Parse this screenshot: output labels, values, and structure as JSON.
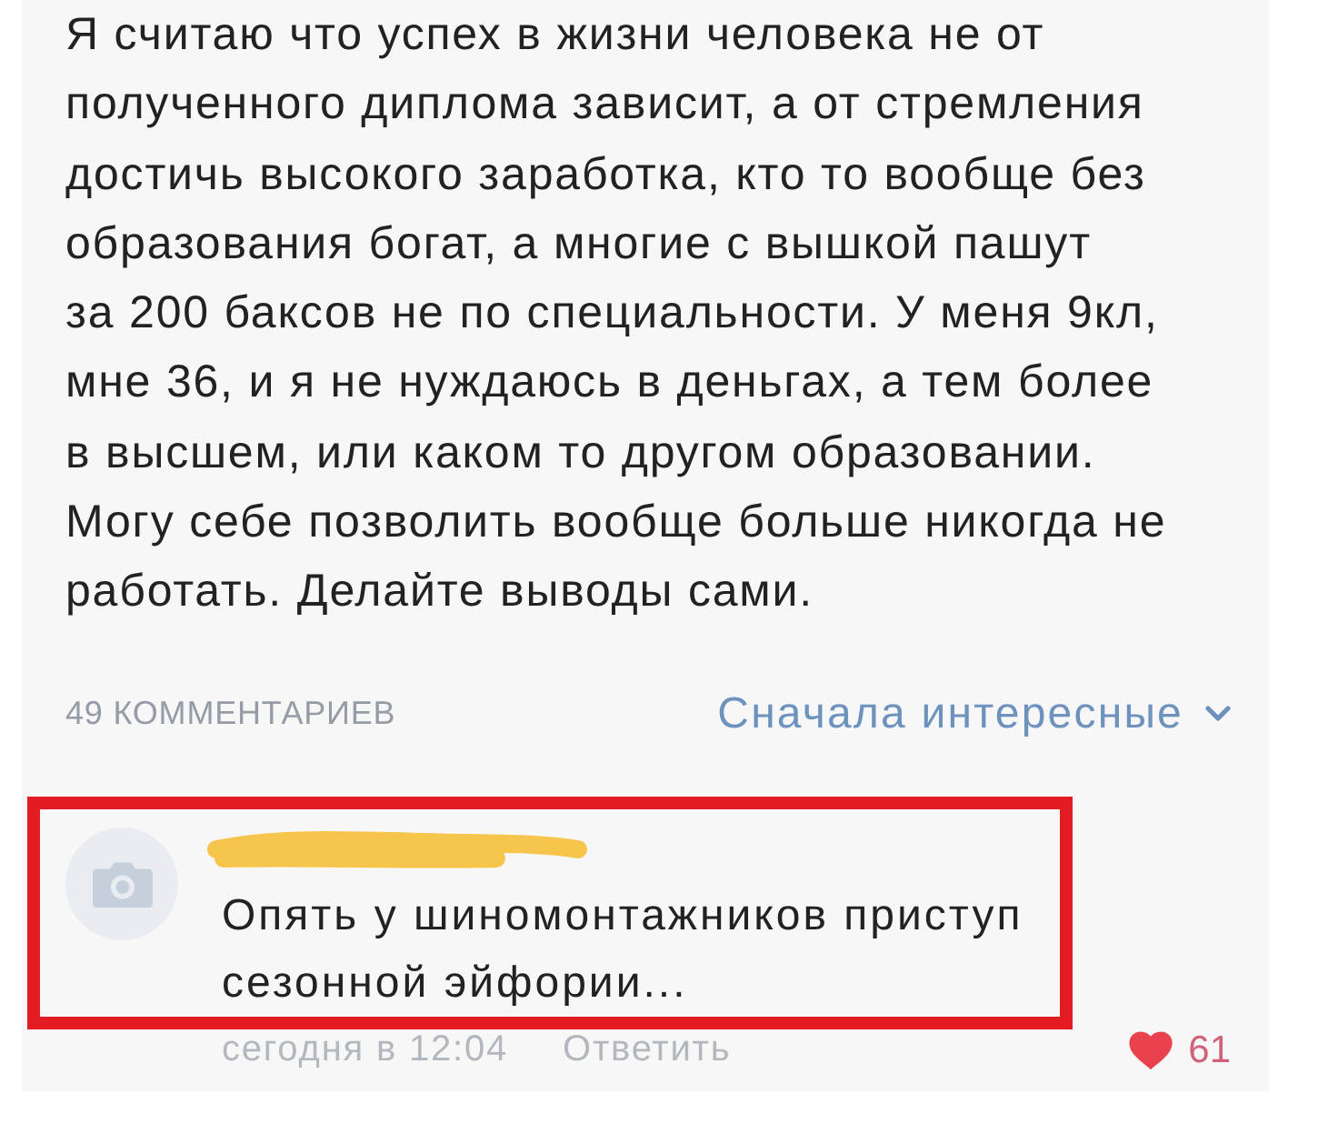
{
  "post": {
    "text": "Я считаю что успех в жизни человека не от\nполученного диплома зависит, а от стремления\nдостичь высокого заработка, кто то вообще без\nобразования богат, а многие с вышкой пашут\nза 200 баксов не по специальности. У меня 9кл,\nмне 36, и я не нуждаюсь в деньгах, а тем более\nв высшем, или каком то другом образовании.\nМогу себе позволить вообще больше никогда не\nработать. Делайте выводы сами."
  },
  "comments_header": {
    "count": "49 КОММЕНТАРИЕВ",
    "sort": "Сначала интересные"
  },
  "comments": [
    {
      "author_redacted": true,
      "highlighted": true,
      "text": "Опять у шиномонтажников приступ\nсезонной эйфории...",
      "time": "сегодня в 12:04",
      "reply": "Ответить",
      "liked": true,
      "likes": "61"
    }
  ]
}
